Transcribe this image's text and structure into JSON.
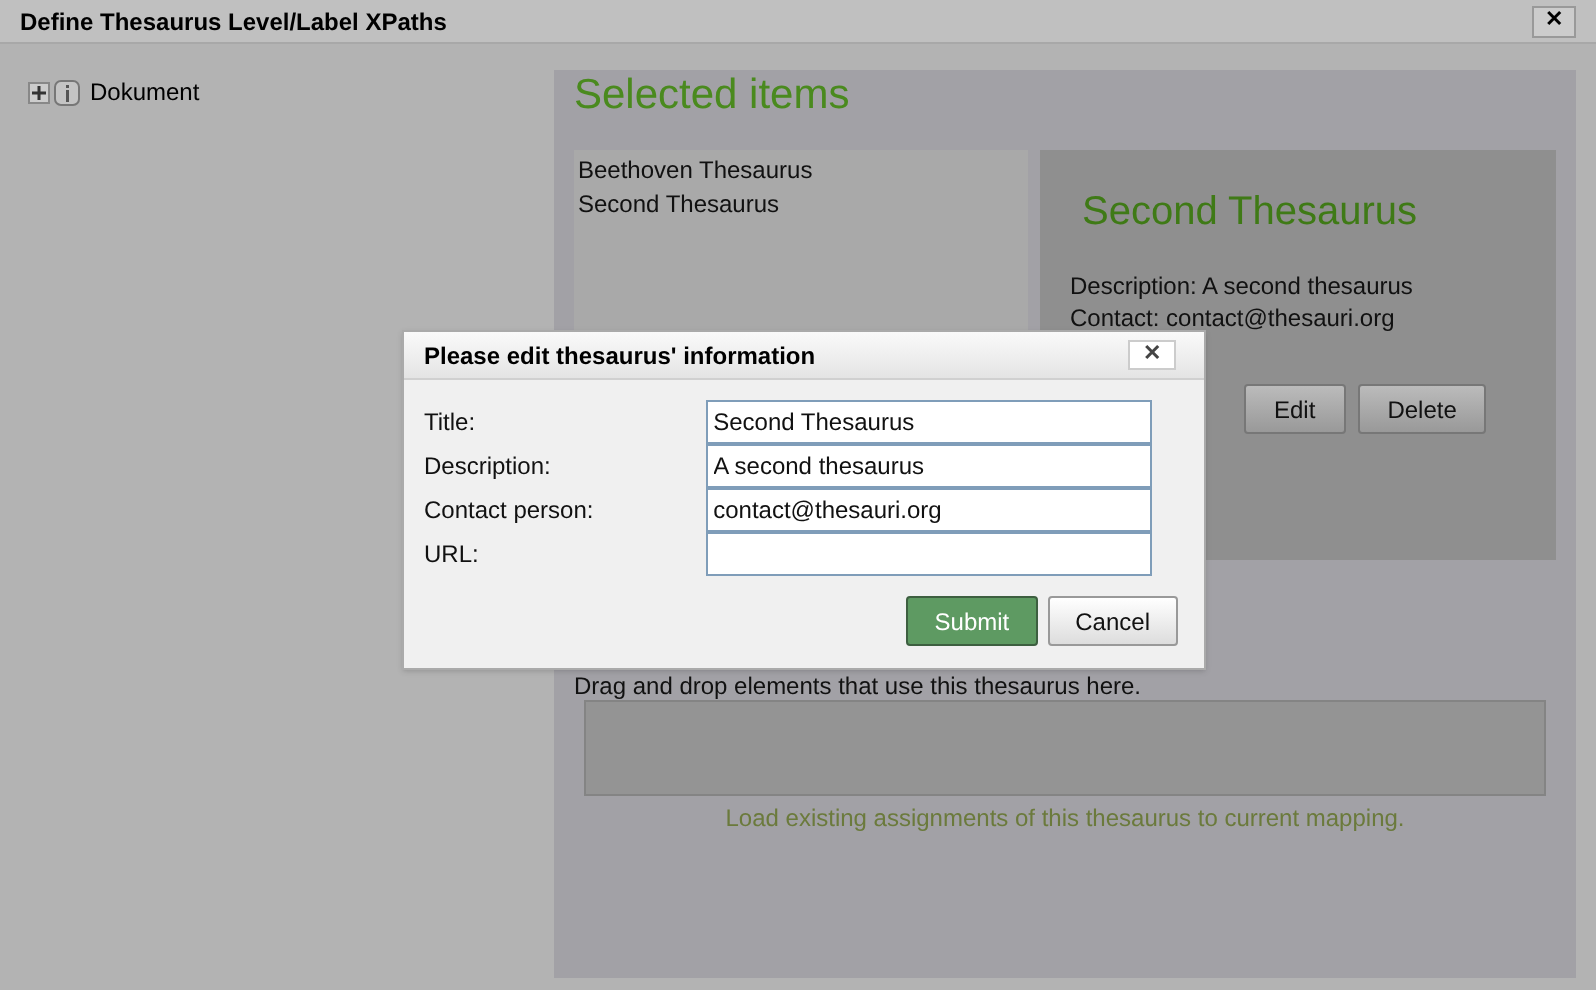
{
  "window": {
    "title": "Define Thesaurus Level/Label XPaths",
    "close": "✕"
  },
  "tree": [
    {
      "label": "Dokument",
      "expanded": false
    }
  ],
  "selected_items": {
    "heading": "Selected items",
    "items": [
      "Beethoven Thesaurus",
      "Second Thesaurus"
    ],
    "detail": {
      "title": "Second Thesaurus",
      "description": "Description: A second thesaurus",
      "contact": "Contact: contact@thesauri.org",
      "buttons": [
        "Edit",
        "Delete"
      ]
    },
    "drop_hint": "Drag and drop elements that use this thesaurus here.",
    "load_link": "Load existing assignments of this thesaurus to current mapping."
  },
  "dialog": {
    "title": "Please edit thesaurus' information",
    "close": "✕",
    "fields": [
      {
        "label": "Title:",
        "value": "Second Thesaurus"
      },
      {
        "label": "Description:",
        "value": "A second thesaurus"
      },
      {
        "label": "Contact person:",
        "value": "contact@thesauri.org"
      },
      {
        "label": "URL:"
      }
    ],
    "buttons": [
      {
        "label": "Submit",
        "kind": "primary"
      },
      {
        "label": "Cancel",
        "kind": "secondary"
      }
    ]
  }
}
